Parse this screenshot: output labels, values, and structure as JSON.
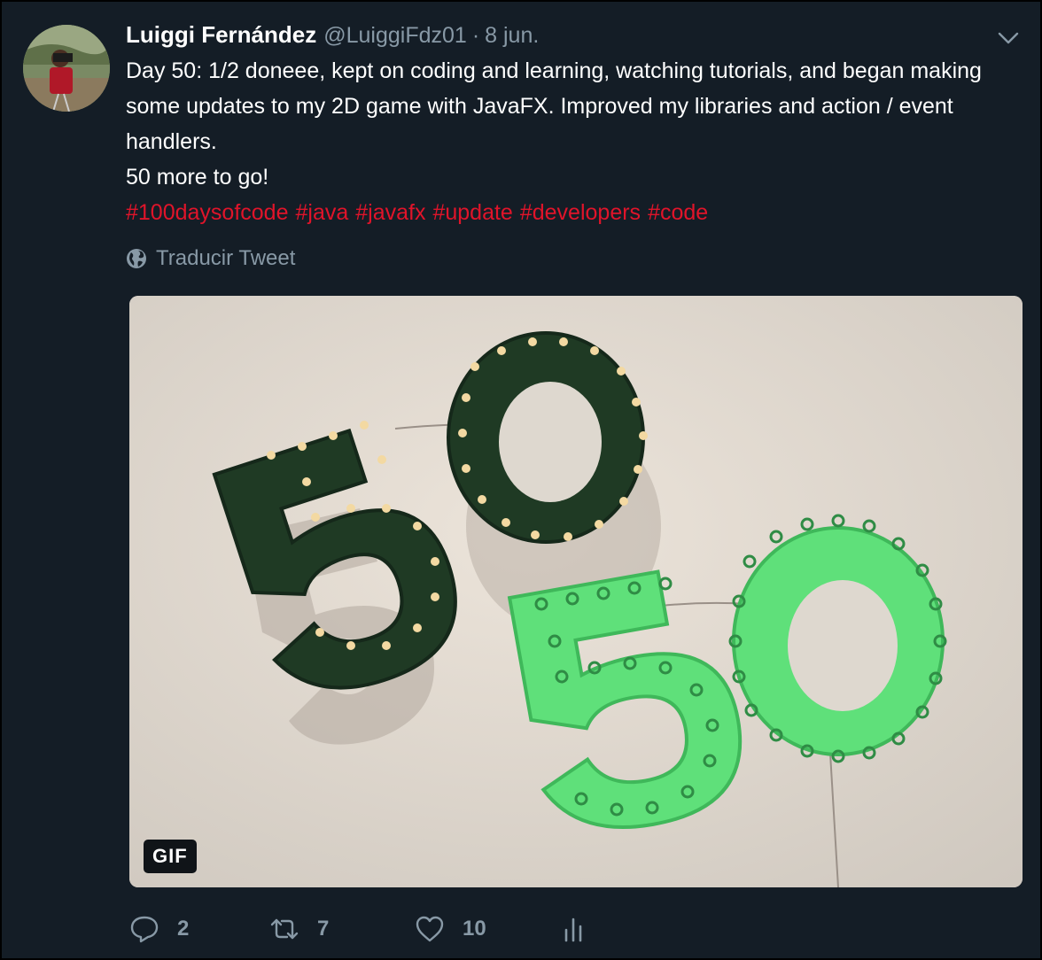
{
  "tweet": {
    "author_name": "Luiggi Fernández",
    "author_handle": "@LuiggiFdz01",
    "separator": "·",
    "date": "8 jun.",
    "text_lines": [
      "Day 50: 1/2 doneee, kept on coding and learning, watching tutorials, and began making some updates to my 2D game with JavaFX. Improved my libraries and action / event handlers.",
      "50 more to go!"
    ],
    "hashtags": [
      "#100daysofcode",
      "#java",
      "#javafx",
      "#update",
      "#developers",
      "#code"
    ],
    "translate_label": "Traducir Tweet",
    "media": {
      "badge": "GIF",
      "description_icon": "marquee-50-image"
    },
    "actions": {
      "replies": "2",
      "retweets": "7",
      "likes": "10"
    },
    "icons": {
      "menu": "chevron-down-icon",
      "translate": "globe-icon",
      "reply": "reply-icon",
      "retweet": "retweet-icon",
      "like": "heart-icon",
      "stats": "analytics-icon"
    },
    "colors": {
      "background": "#141d26",
      "text": "#ffffff",
      "secondary_text": "#8899a6",
      "hashtag": "#e0142a"
    }
  }
}
